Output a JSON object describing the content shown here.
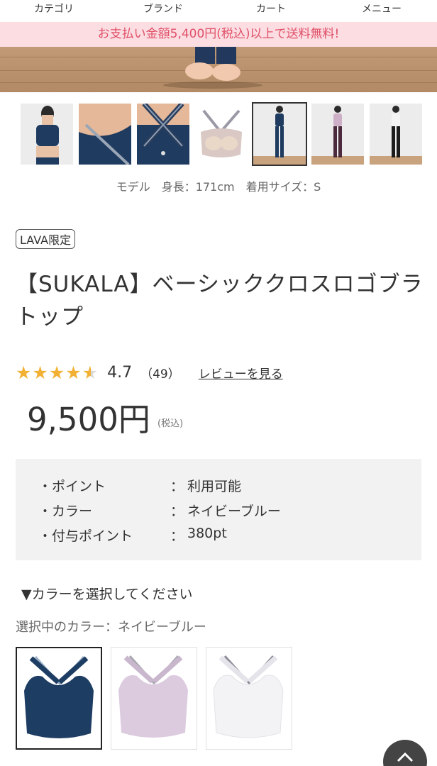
{
  "nav": {
    "items": [
      {
        "label": "カテゴリ"
      },
      {
        "label": "ブランド"
      },
      {
        "label": "カート"
      },
      {
        "label": "メニュー"
      }
    ]
  },
  "promo": {
    "text": "お支払い金額5,400円(税込)以上で送料無料!"
  },
  "gallery": {
    "caption": "モデル　身長：171cm　着用サイズ：S",
    "selected_index": 4
  },
  "product": {
    "badge": "LAVA限定",
    "title": "【SUKALA】ベーシッククロスロゴブラトップ",
    "rating": {
      "stars": 4.7,
      "value": "4.7",
      "count": "（49）",
      "link": "レビューを見る"
    },
    "price": "9,500円",
    "tax_note": "(税込)"
  },
  "info": {
    "rows": [
      {
        "label": "・ポイント",
        "colon": "：",
        "value": "利用可能"
      },
      {
        "label": "・カラー",
        "colon": "：",
        "value": "ネイビーブルー"
      },
      {
        "label": "・付与ポイント",
        "colon": "：",
        "value": "380pt"
      }
    ]
  },
  "color_select": {
    "heading": "▼カラーを選択してください",
    "selected_label": "選択中のカラー：ネイビーブルー",
    "swatches": [
      {
        "name": "navy",
        "color": "#1e3d63"
      },
      {
        "name": "pink",
        "color": "#dccbdf"
      },
      {
        "name": "white",
        "color": "#f3f3f6"
      }
    ]
  },
  "colors": {
    "accent_pink": "#e05068",
    "promo_bg": "#fbdde2",
    "star": "#f2b134"
  }
}
